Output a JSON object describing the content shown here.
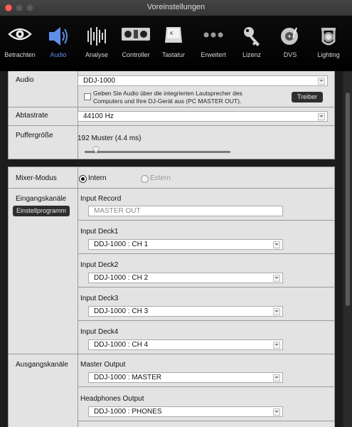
{
  "window": {
    "title": "Voreinstellungen"
  },
  "toolbar": {
    "items": [
      {
        "label": "Betrachten",
        "icon": "eye-icon"
      },
      {
        "label": "Audio",
        "icon": "speaker-icon",
        "active": true
      },
      {
        "label": "Analyse",
        "icon": "waveform-icon"
      },
      {
        "label": "Controller",
        "icon": "controller-icon"
      },
      {
        "label": "Tastatur",
        "icon": "keyboard-key-icon"
      },
      {
        "label": "Erweitert",
        "icon": "three-dots-icon"
      },
      {
        "label": "Lizenz",
        "icon": "key-icon"
      },
      {
        "label": "DVS",
        "icon": "turntable-icon"
      },
      {
        "label": "Lighting",
        "icon": "moving-head-light-icon"
      }
    ],
    "active_color": "#5d8fe8"
  },
  "audio": {
    "label": "Audio",
    "device": "DDJ-1000",
    "checkbox_text_1": "Geben Sie Audio über die integrierten Lautsprecher des",
    "checkbox_text_2": "Computers und Ihre DJ-Gerät aus (PC MASTER OUT).",
    "driver_button": "Treiber"
  },
  "sample_rate": {
    "label": "Abtastrate",
    "value": "44100 Hz"
  },
  "buffer": {
    "label": "Puffergröße",
    "value": "192 Muster (4.4 ms)",
    "slider_fraction": 0.06
  },
  "mixer": {
    "label": "Mixer-Modus",
    "option_internal": "Intern",
    "option_external": "Extern",
    "selected": "Intern"
  },
  "inputs": {
    "label": "Eingangskanäle",
    "setup_button": "Einstellprogramm",
    "record_label": "Input Record",
    "record_value": "MASTER OUT",
    "deck1_label": "Input Deck1",
    "deck1_value": "DDJ-1000 : CH 1",
    "deck2_label": "Input Deck2",
    "deck2_value": "DDJ-1000 : CH 2",
    "deck3_label": "Input Deck3",
    "deck3_value": "DDJ-1000 : CH 3",
    "deck4_label": "Input Deck4",
    "deck4_value": "DDJ-1000 : CH 4"
  },
  "outputs": {
    "label": "Ausgangskanäle",
    "master_label": "Master Output",
    "master_value": "DDJ-1000 : MASTER",
    "phones_label": "Headphones Output",
    "phones_value": "DDJ-1000 : PHONES"
  }
}
